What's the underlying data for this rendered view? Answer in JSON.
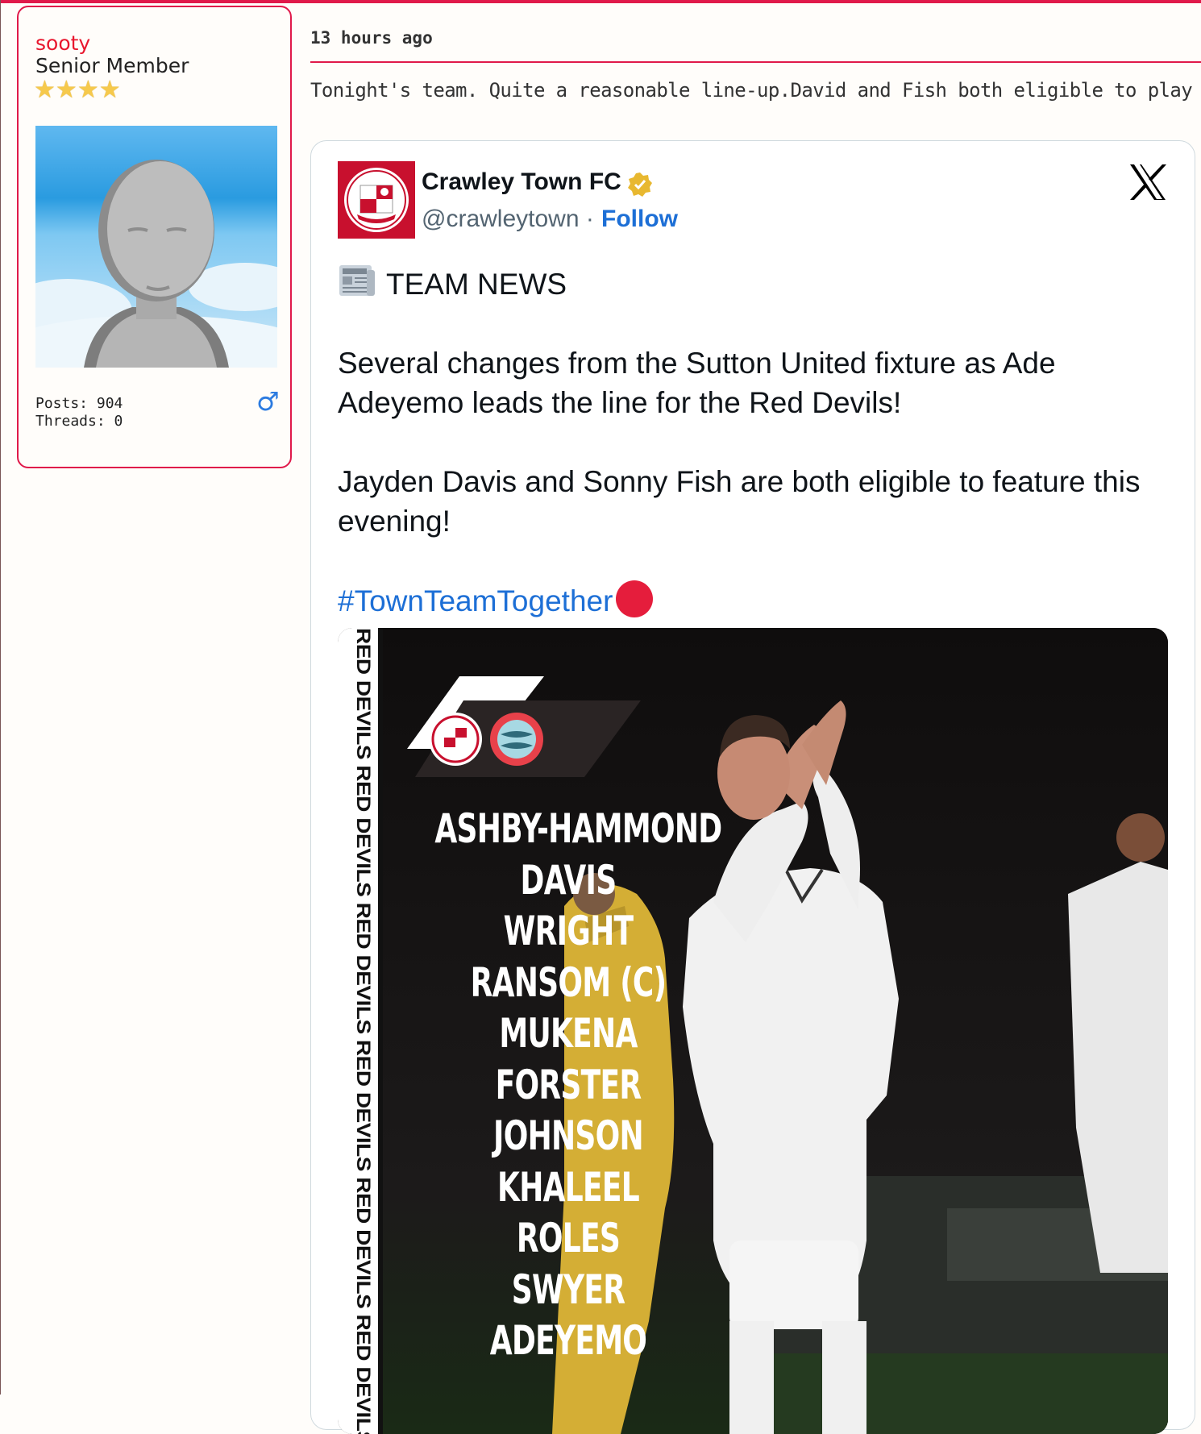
{
  "user": {
    "username": "sooty",
    "rank": "Senior Member",
    "stars": [
      "★",
      "★",
      "★",
      "★"
    ],
    "posts_label": "Posts: 904",
    "threads_label": "Threads: 0",
    "gender_icon": "male-icon",
    "gender_symbol": "♂"
  },
  "post": {
    "timestamp": "13 hours ago",
    "text": "Tonight's team. Quite a reasonable line-up.David and Fish both eligible to play"
  },
  "tweet": {
    "name": "Crawley Town FC",
    "handle": "@crawleytown",
    "separator": "·",
    "follow_label": "Follow",
    "heading": "TEAM NEWS",
    "paragraph_1": "Several changes from the Sutton United fixture as Ade Adeyemo leads the line for the Red Devils!",
    "paragraph_2": "Jayden Davis and Sonny Fish are both eligible to feature this evening!",
    "hashtag": "#TownTeamTogether",
    "media": {
      "strip_text": "RED DEVILS   RED DEVILS   RED DEVILS   RED DEVILS   RED DEVILS   RED DEVILS",
      "lineup": [
        "ASHBY-HAMMOND",
        "DAVIS",
        "WRIGHT",
        "RANSOM (C)",
        "MUKENA",
        "FORSTER",
        "JOHNSON",
        "KHALEEL",
        "ROLES",
        "SWYER",
        "ADEYEMO"
      ]
    }
  },
  "colors": {
    "accent": "#e0194a",
    "username": "#e8172e",
    "link": "#1d6fd6",
    "crawley_red": "#c8102e"
  }
}
